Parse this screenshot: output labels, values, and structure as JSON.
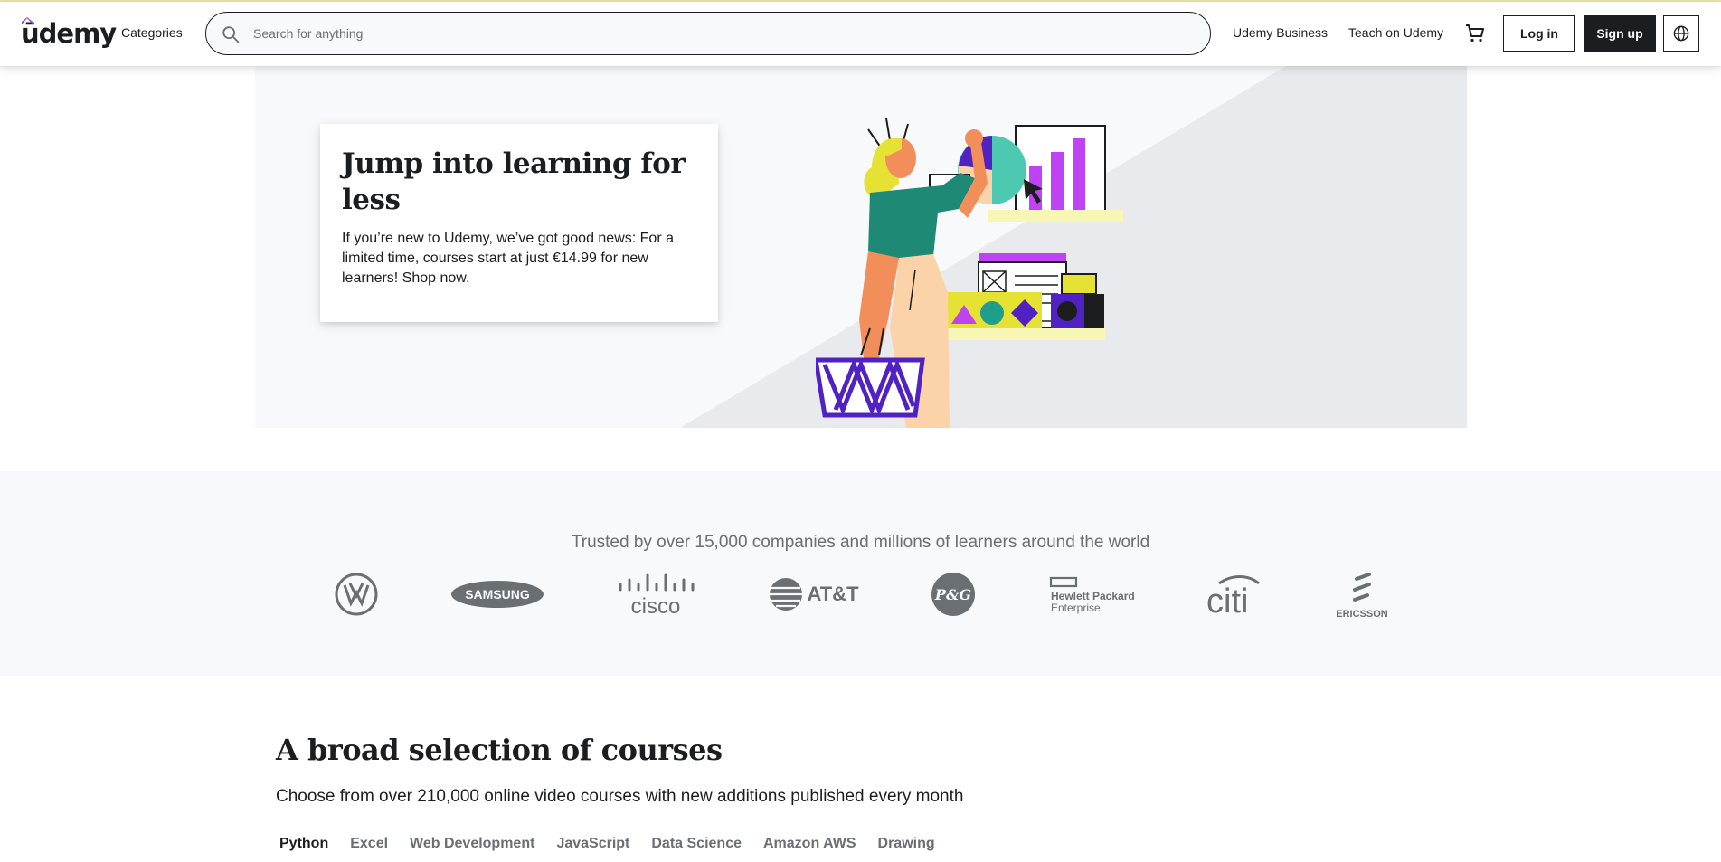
{
  "header": {
    "logo_text": "ūdemy",
    "categories_label": "Categories",
    "search_placeholder": "Search for anything",
    "business_label": "Udemy Business",
    "teach_label": "Teach on Udemy",
    "login_label": "Log in",
    "signup_label": "Sign up"
  },
  "hero": {
    "title": "Jump into learning for less",
    "text": "If you’re new to Udemy, we’ve got good news: For a limited time, courses start at just €14.99 for new learners! Shop now."
  },
  "trusted": {
    "text": "Trusted by over 15,000 companies and millions of learners around the world",
    "companies": [
      "Volkswagen",
      "SAMSUNG",
      "cisco",
      "AT&T",
      "P&G",
      "Hewlett Packard Enterprise",
      "citi",
      "ERICSSON"
    ]
  },
  "courses": {
    "title": "A broad selection of courses",
    "subtitle": "Choose from over 210,000 online video courses with new additions published every month",
    "tabs": [
      "Python",
      "Excel",
      "Web Development",
      "JavaScript",
      "Data Science",
      "Amazon AWS",
      "Drawing"
    ],
    "active_tab": "Python"
  },
  "colors": {
    "brand_purple": "#a435f0",
    "dark": "#1c1d1f",
    "muted": "#6a6f73",
    "hero_bg": "#e9eaee"
  },
  "icons": [
    "search-icon",
    "cart-icon",
    "globe-icon"
  ]
}
